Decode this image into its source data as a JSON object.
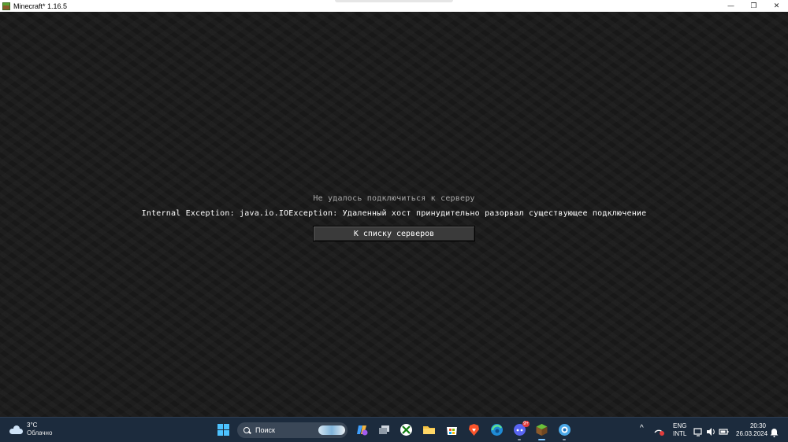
{
  "window": {
    "title": "Minecraft* 1.16.5",
    "controls": {
      "minimize": "—",
      "restore": "❐",
      "close": "✕"
    }
  },
  "game": {
    "disconnect_title": "Не удалось подключиться к серверу",
    "disconnect_reason": "Internal Exception: java.io.IOException: Удаленный хост принудительно разорвал существующее подключение",
    "back_button_label": "К списку серверов"
  },
  "taskbar": {
    "weather": {
      "temperature": "3°C",
      "condition": "Облачно",
      "icon": "cloud-icon"
    },
    "search": {
      "label": "Поиск"
    },
    "apps": [
      {
        "name": "copilot",
        "icon": "copilot-icon"
      },
      {
        "name": "task-view",
        "icon": "task-view-icon"
      },
      {
        "name": "xbox",
        "icon": "xbox-icon"
      },
      {
        "name": "file-explorer",
        "icon": "folder-icon"
      },
      {
        "name": "microsoft-store",
        "icon": "store-icon"
      },
      {
        "name": "brave",
        "icon": "brave-icon"
      },
      {
        "name": "edge",
        "icon": "edge-icon"
      },
      {
        "name": "discord",
        "icon": "discord-icon",
        "badge": "9+"
      },
      {
        "name": "minecraft",
        "icon": "minecraft-icon"
      },
      {
        "name": "unknown-app",
        "icon": "globe-icon"
      }
    ],
    "tray": {
      "language_line1": "ENG",
      "language_line2": "INTL",
      "time": "20:30",
      "date": "26.03.2024",
      "overflow_glyph": "^"
    }
  },
  "colors": {
    "taskbar_bg": "#1c2b3d",
    "game_bg": "#1a1a1a",
    "button_bg": "#3a3a3a",
    "title_text": "#a8a8a8",
    "accent": "#4cc2ff"
  }
}
